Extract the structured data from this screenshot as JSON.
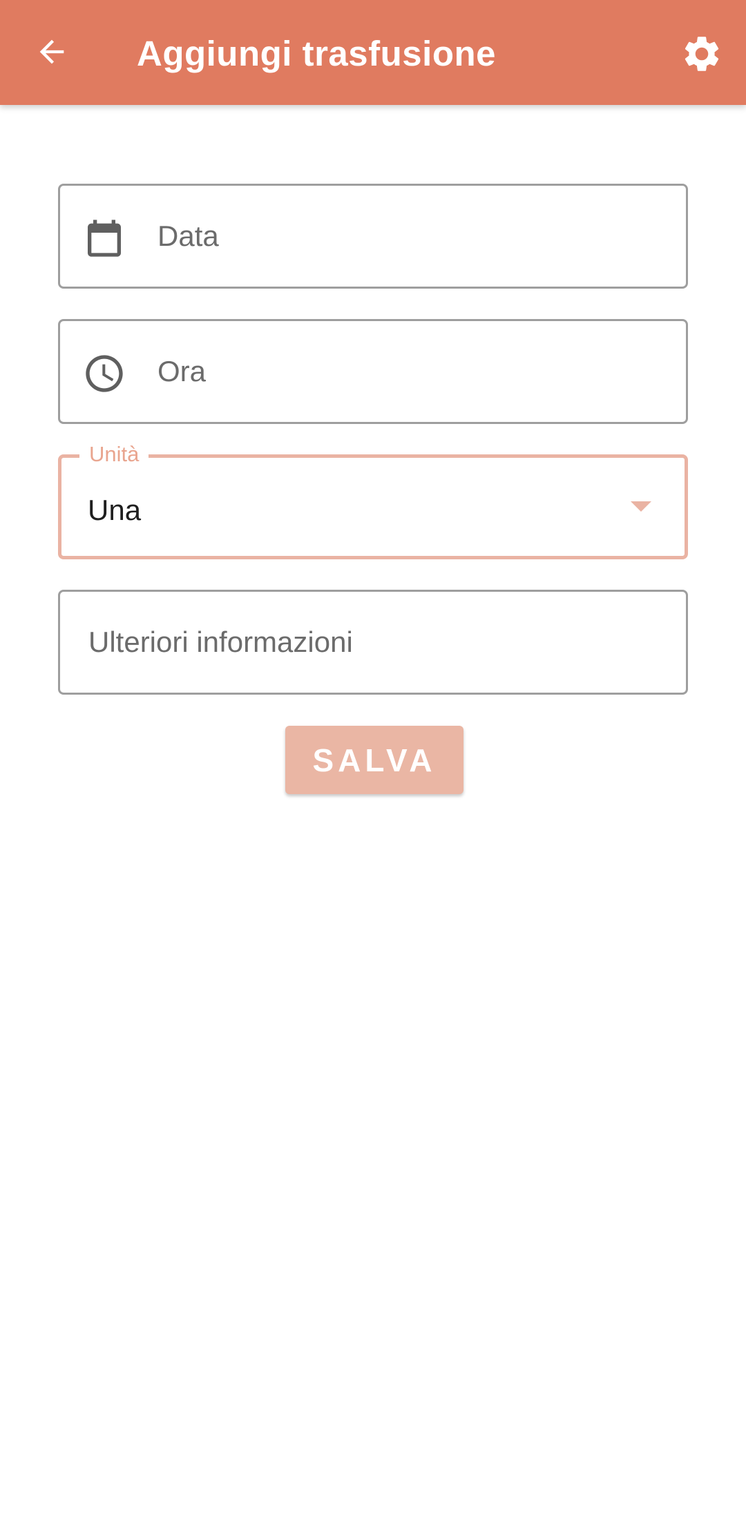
{
  "app_bar": {
    "title": "Aggiungi trasfusione",
    "back_icon": "arrow-back-icon",
    "settings_icon": "gear-icon",
    "background_color": "#e07b60"
  },
  "form": {
    "date_field": {
      "placeholder": "Data",
      "icon": "calendar-icon"
    },
    "time_field": {
      "placeholder": "Ora",
      "icon": "clock-icon"
    },
    "units_field": {
      "label": "Unità",
      "value": "Una",
      "accent_color": "#eab3a3"
    },
    "notes_field": {
      "placeholder": "Ulteriori informazioni"
    },
    "save_button": {
      "label": "SALVA",
      "color": "#eab6a4"
    }
  }
}
